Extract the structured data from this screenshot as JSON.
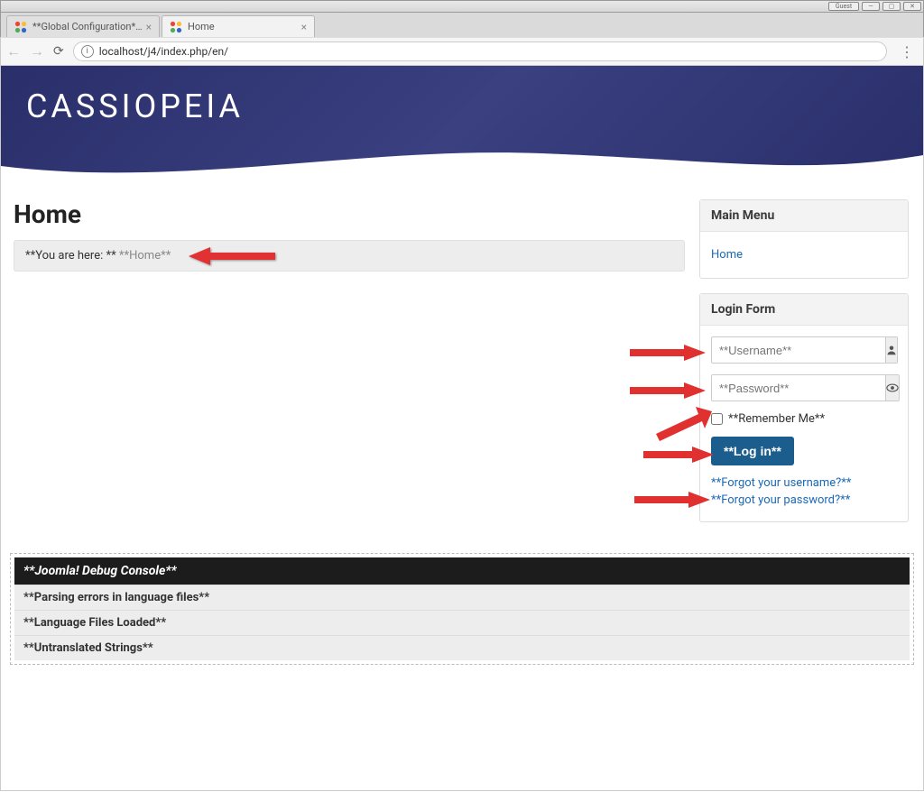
{
  "window": {
    "guest_label": "Guest"
  },
  "browser": {
    "tabs": [
      {
        "title": "**Global Configuration** - ",
        "active": false
      },
      {
        "title": "Home",
        "active": true
      }
    ],
    "url": "localhost/j4/index.php/en/"
  },
  "hero": {
    "brand": "CASSIOPEIA"
  },
  "page": {
    "title": "Home",
    "breadcrumb_prefix": "**You are here: **",
    "breadcrumb_current": "**Home**"
  },
  "sidebar": {
    "main_menu": {
      "heading": "Main Menu",
      "items": [
        {
          "label": "Home"
        }
      ]
    },
    "login": {
      "heading": "Login Form",
      "username_placeholder": "**Username**",
      "password_placeholder": "**Password**",
      "remember_label": "**Remember Me**",
      "login_button": "**Log in**",
      "forgot_username": "**Forgot your username?**",
      "forgot_password": "**Forgot your password?**"
    }
  },
  "debug": {
    "title": "**Joomla! Debug Console**",
    "rows": [
      "**Parsing errors in language files**",
      "**Language Files Loaded**",
      "**Untranslated Strings**"
    ]
  }
}
